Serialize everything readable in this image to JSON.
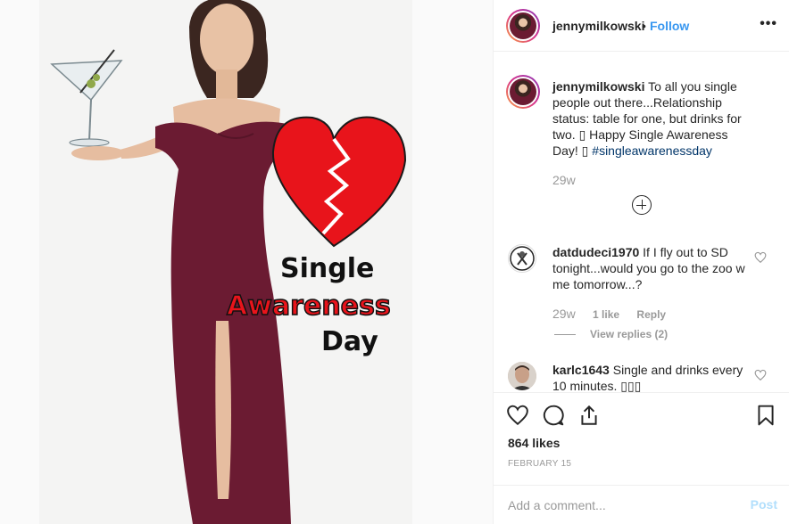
{
  "post": {
    "username": "jennymilkowski",
    "separator": "•",
    "follow_label": "Follow",
    "more_label": "•••",
    "caption_username": "jennymilkowski",
    "caption_text": " To all you single people out there...Relationship status: table for one, but drinks for two. ▯ Happy Single Awareness Day! ▯ ",
    "caption_hashtag": "#singleawarenessday",
    "caption_time": "29w",
    "image_text": {
      "line1": "Single",
      "line2": "Awareness",
      "line3": "Day"
    },
    "colors": {
      "dress": "#6b1b32",
      "heart": "#e8141b",
      "awareness_text": "#e8141b",
      "follow": "#3897f0",
      "hashtag": "#003569"
    }
  },
  "comments": [
    {
      "username": "datdudeci1970",
      "text": " If I fly out to SD tonight...would you go to the zoo w me tomorrow...?",
      "time": "29w",
      "likes": "1 like",
      "reply_label": "Reply",
      "view_replies": "View replies (2)"
    },
    {
      "username": "karlc1643",
      "text": " Single and drinks every 10 minutes. ▯▯▯"
    }
  ],
  "actions": {
    "like_icon": "heart-icon",
    "comment_icon": "comment-icon",
    "share_icon": "share-icon",
    "save_icon": "bookmark-icon",
    "likes_count": "864 likes",
    "date": "FEBRUARY 15"
  },
  "add_comment": {
    "placeholder": "Add a comment...",
    "post_label": "Post"
  }
}
